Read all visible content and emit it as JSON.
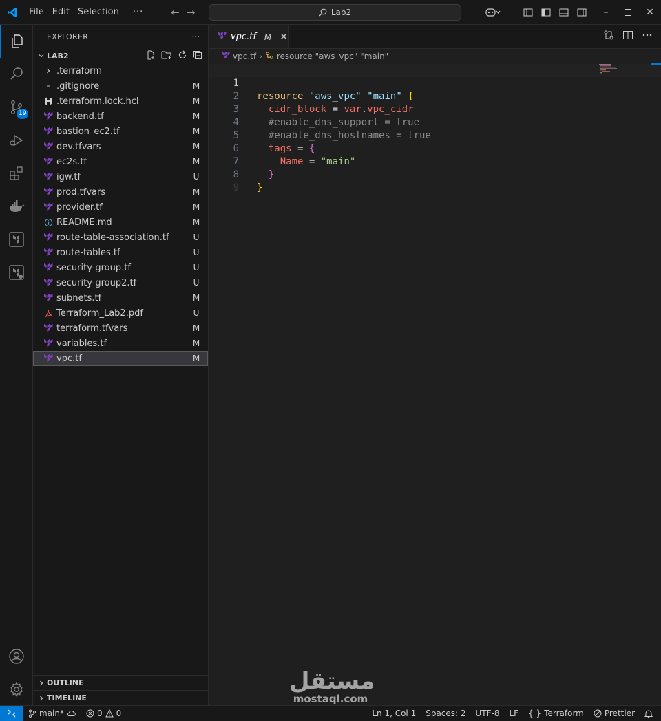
{
  "titlebar": {
    "menus": [
      "File",
      "Edit",
      "Selection"
    ],
    "more": "···",
    "search": "Lab2"
  },
  "activity": {
    "scm_badge": "19"
  },
  "sidebar": {
    "header": "EXPLORER",
    "more": "···",
    "folder": "LAB2",
    "files": [
      {
        "name": ".terraform",
        "status": "",
        "icon": "chevron-right-icon"
      },
      {
        "name": ".gitignore",
        "status": "M",
        "icon": "git-icon"
      },
      {
        "name": ".terraform.lock.hcl",
        "status": "M",
        "icon": "hcl-icon"
      },
      {
        "name": "backend.tf",
        "status": "M",
        "icon": "terraform-icon"
      },
      {
        "name": "bastion_ec2.tf",
        "status": "M",
        "icon": "terraform-icon"
      },
      {
        "name": "dev.tfvars",
        "status": "M",
        "icon": "terraform-icon"
      },
      {
        "name": "ec2s.tf",
        "status": "M",
        "icon": "terraform-icon"
      },
      {
        "name": "igw.tf",
        "status": "U",
        "icon": "terraform-icon"
      },
      {
        "name": "prod.tfvars",
        "status": "M",
        "icon": "terraform-icon"
      },
      {
        "name": "provider.tf",
        "status": "M",
        "icon": "terraform-icon"
      },
      {
        "name": "README.md",
        "status": "M",
        "icon": "info-icon"
      },
      {
        "name": "route-table-association.tf",
        "status": "U",
        "icon": "terraform-icon"
      },
      {
        "name": "route-tables.tf",
        "status": "U",
        "icon": "terraform-icon"
      },
      {
        "name": "security-group.tf",
        "status": "U",
        "icon": "terraform-icon"
      },
      {
        "name": "security-group2.tf",
        "status": "U",
        "icon": "terraform-icon"
      },
      {
        "name": "subnets.tf",
        "status": "M",
        "icon": "terraform-icon"
      },
      {
        "name": "Terraform_Lab2.pdf",
        "status": "U",
        "icon": "pdf-icon"
      },
      {
        "name": "terraform.tfvars",
        "status": "M",
        "icon": "terraform-icon"
      },
      {
        "name": "variables.tf",
        "status": "M",
        "icon": "terraform-icon"
      },
      {
        "name": "vpc.tf",
        "status": "M",
        "icon": "terraform-icon"
      }
    ],
    "outline": "OUTLINE",
    "timeline": "TIMELINE"
  },
  "editor": {
    "tab": {
      "label": "vpc.tf",
      "modified": "M",
      "close": "✕"
    },
    "breadcrumb": {
      "file": "vpc.tf",
      "symbol": "resource \"aws_vpc\" \"main\""
    },
    "line_numbers": [
      "1",
      "2",
      "3",
      "4",
      "5",
      "6",
      "7",
      "8",
      "9"
    ]
  },
  "statusbar": {
    "branch": "main*",
    "errors": "0",
    "warnings": "0",
    "position": "Ln 1, Col 1",
    "spaces": "Spaces: 2",
    "encoding": "UTF-8",
    "eol": "LF",
    "language": "Terraform",
    "formatter": "Prettier"
  },
  "watermark": {
    "arabic": "مستقل",
    "latin": "mostaql.com"
  },
  "colors": {
    "accent": "#0078d4",
    "terraform": "#7b42bc"
  }
}
